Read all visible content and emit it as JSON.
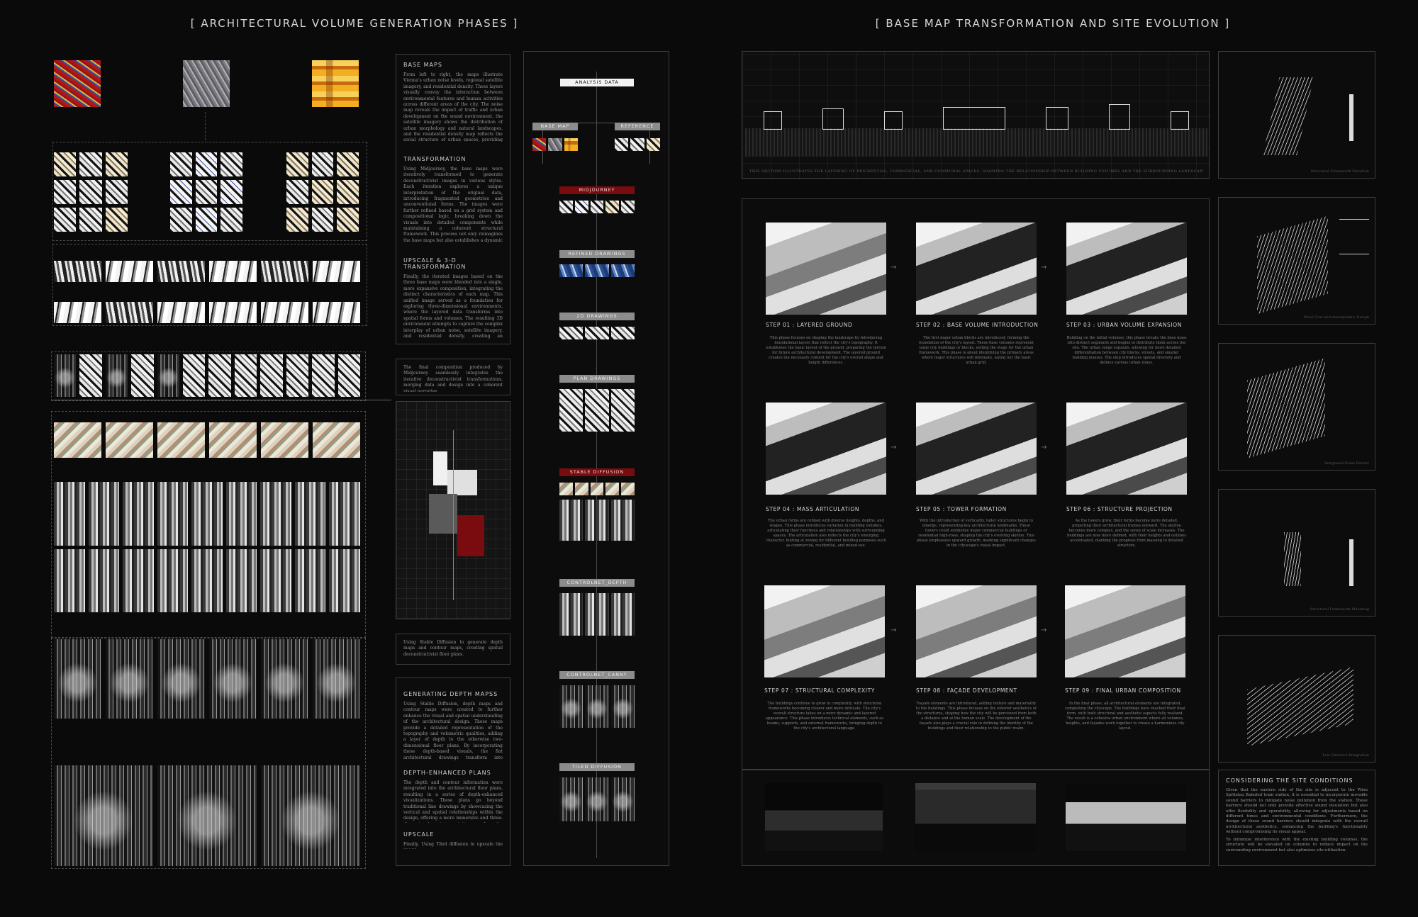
{
  "headings": {
    "left": "[ ARCHITECTURAL VOLUME GENERATION PHASES ]",
    "right": "[ BASE MAP TRANSFORMATION AND SITE EVOLUTION ]"
  },
  "text_column": {
    "base_maps": {
      "title": "BASE MAPS",
      "body": "From left to right, the maps illustrate Vienna's urban noise levels, regional satellite imagery, and residential density. These layers visually convey the interaction between environmental features and human activities across different areas of the city. The noise map reveals the impact of traffic and urban development on the sound environment, the satellite imagery shows the distribution of urban morphology and natural landscapes, and the residential density map reflects the social structure of urban spaces, providing multidimensional foundational data for subsequent design work."
    },
    "transformation": {
      "title": "TRANSFORMATION",
      "body": "Using Midjourney, the base maps were iteratively transformed to generate deconstructivist images in various styles. Each iteration explores a unique interpretation of the original data, introducing fragmented geometries and unconventional forms. The images were further refined based on a grid system and compositional logic, breaking down the visuals into detailed components while maintaining a coherent structural framework. This process not only reimagines the base maps but also establishes a dynamic dialogue between data and architectural expression."
    },
    "upscale": {
      "title": "UPSCALE & 3-D TRANSFORMATION",
      "body": "Finally, the iterated images based on the three base maps were blended into a single, more expansive composition, integrating the distinct characteristics of each map. This unified image served as a foundation for exploring three-dimensional environments, where the layered data transforms into spatial forms and volumes. The resulting 3D environment attempts to capture the complex interplay of urban noise, satellite imagery, and residential density, creating an immersive representation that bridges the gap between abstract visualization and architectural spatiality."
    },
    "final_comp": "The final composition produced by Midjourney seamlessly integrates the iterative deconstructivist transformations, merging data and design into a coherent visual narrative.",
    "stable_note": "Using Stable Diffusion to generate depth maps and contour maps, creating spatial deconstructivist floor plans.",
    "depth_maps": {
      "title": "GENERATING DEPTH MAPSS",
      "body": "Using Stable Diffusion, depth maps and contour maps were created to further enhance the visual and spatial understanding of the architectural design. These maps provide a detailed representation of the topography and volumetric qualities, adding a layer of depth to the otherwise two-dimensional floor plans. By incorporating these depth-based visuals, the flat architectural drawings transform into enriched representations, highlighting the spatial hierarchy and the interplay between different design elements."
    },
    "depth_plans": {
      "title": "DEPTH-ENHANCED PLANS",
      "body": "The depth and contour information were integrated into the architectural floor plans, resulting in a series of depth-enhanced visualizations. These plans go beyond traditional line drawings by showcasing the vertical and spatial relationships within the design, offering a more immersive and three-dimensional interpretation of the architectural concept."
    },
    "upscale2": {
      "title": "UPSCALE",
      "body": "Finally, Using Tiled diffusion to upscale the image."
    }
  },
  "pipeline": {
    "analysis": "ANALYSIS DATA",
    "base_map": "BASE MAP",
    "reference": "REFERENCE",
    "midjourney": "MIDJOURNEY",
    "refined": "REFINED DRAWINGS",
    "drawings_2d": "2D DRAWINGS",
    "plan": "PLAN DRAWINGS",
    "stable": "STABLE DIFFUSION",
    "cn_depth": "CONTROLNET_DEPTH",
    "cn_canny": "CONTROLNET_CANNY",
    "tiled": "TILED DIFFUSION"
  },
  "section_caption": "THIS SECTION ILLUSTRATES THE LAYERING OF RESIDENTIAL, COMMERCIAL, AND COMMUNAL SPACES, SHOWING THE RELATIONSHIP BETWEEN BUILDING VOLUMES AND THE SURROUNDING LANDSCAPE.",
  "steps": [
    {
      "label": "STEP 01 : LAYERED GROUND",
      "desc": "This phase focuses on shaping the landscape by introducing foundational layers that reflect the city's topography. It establishes the basic layout of the ground, preparing the terrain for future architectural development. The layered ground creates the necessary context for the city's overall shape and height differences."
    },
    {
      "label": "STEP 02 : BASE VOLUME INTRODUCTION",
      "desc": "The first major urban blocks are introduced, forming the foundation of the city's layout. These base volumes represent large city buildings or blocks, setting the stage for the urban framework. This phase is about identifying the primary areas where major structures will dominate, laying out the basic urban grid."
    },
    {
      "label": "STEP 03 : URBAN VOLUME EXPANSION",
      "desc": "Building on the initial volumes, this phase breaks the base mass into distinct segments and begins to distribute them across the site. The urban range expands, allowing for more detailed differentiation between city blocks, streets, and smaller building masses. The step introduces spatial diversity and defines various urban zones."
    },
    {
      "label": "STEP 04 : MASS ARTICULATION",
      "desc": "The urban forms are refined with diverse heights, depths, and shapes. This phase introduces variation in building volumes, articulating their functions and relationships with surrounding spaces. The articulation also reflects the city's emerging character, hinting at zoning for different building purposes such as commercial, residential, and mixed-use."
    },
    {
      "label": "STEP 05 : TOWER FORMATION",
      "desc": "With the introduction of verticality, taller structures begin to emerge, representing key architectural landmarks. These towers could symbolize major commercial buildings or residential high-rises, shaping the city's evolving skyline. This phase emphasizes upward growth, marking significant changes in the cityscape's visual impact."
    },
    {
      "label": "STEP 06 : STRUCTURE PROJECTION",
      "desc": "As the towers grow, their forms become more detailed, projecting their architectural frames outward. The skyline becomes more complex, and the sense of scale increases. The buildings are now more defined, with their heights and outlines accentuated, marking the progress from massing to detailed structure."
    },
    {
      "label": "STEP 07 : STRUCTURAL COMPLEXITY",
      "desc": "The buildings continue to grow in complexity, with structural frameworks becoming clearer and more intricate. The city's overall structure takes on a more dynamic and layered appearance. This phase introduces technical elements, such as beams, supports, and external frameworks, bringing depth to the city's architectural language."
    },
    {
      "label": "STEP 08 : FAÇADE DEVELOPMENT",
      "desc": "Façade elements are introduced, adding texture and materiality to the buildings. This phase focuses on the exterior aesthetics of the structures, shaping how the city will be perceived from both a distance and at the human scale. The development of the façade also plays a crucial role in defining the identity of the buildings and their relationship to the public realm."
    },
    {
      "label": "STEP 09 : FINAL URBAN COMPOSITION",
      "desc": "In the final phase, all architectural elements are integrated, completing the cityscape. The buildings have reached their final form, with both structural and aesthetic aspects fully realized. The result is a cohesive urban environment where all volumes, heights, and façades work together to create a harmonious city layout."
    }
  ],
  "axo_captions": [
    "Structural Framework Elevation",
    "Wind Flow and Aerodynamic Design",
    "Integrated Noise Barrier",
    "Structural Framework Mounting",
    "Low Entrance Integration"
  ],
  "site_conditions": {
    "title": "CONSIDERING THE SITE CONDITIONS",
    "body1": "Given that the eastern side of the site is adjacent to the Wien Spittelau Bahnhof train station, it is essential to incorporate movable sound barriers to mitigate noise pollution from the station. These barriers should not only provide effective sound insulation but also offer flexibility and operability, allowing for adjustments based on different times and environmental conditions. Furthermore, the design of these sound barriers should integrate with the overall architectural aesthetics, enhancing the building's functionality without compromising its visual appeal.",
    "body2": "To minimize interference with the existing building volumes, the structure will be elevated on columns to reduce impact on the surrounding environment but also optimizes site utilization."
  }
}
